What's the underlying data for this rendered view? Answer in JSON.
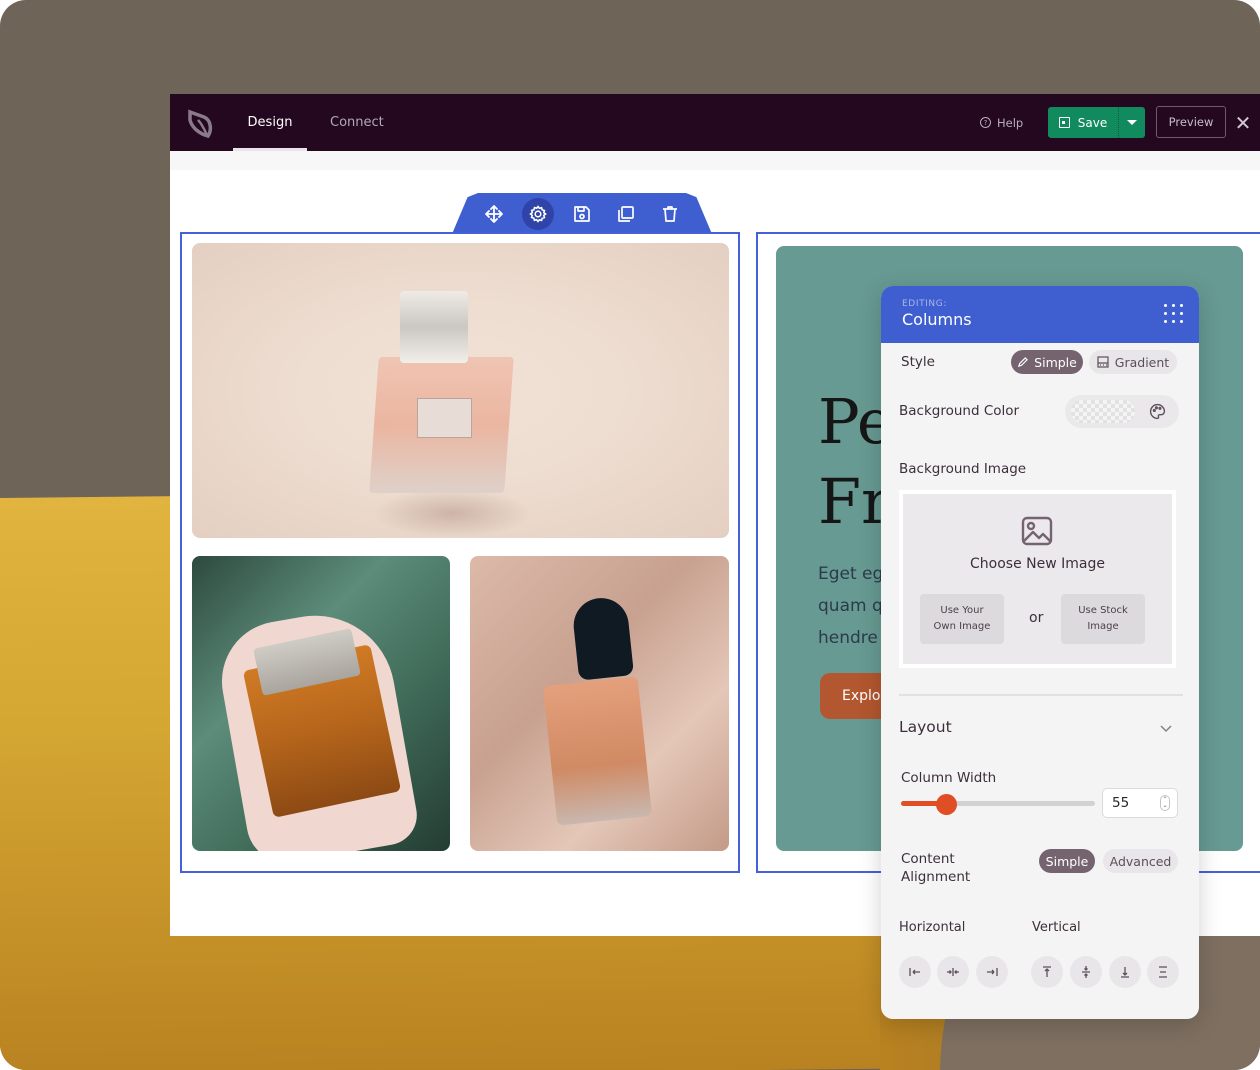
{
  "topbar": {
    "logo_icon": "leaf-logo-icon",
    "tabs": [
      {
        "label": "Design",
        "active": true
      },
      {
        "label": "Connect",
        "active": false
      }
    ],
    "help_label": "Help",
    "save_label": "Save",
    "preview_label": "Preview"
  },
  "block_toolbar": {
    "buttons": [
      {
        "icon": "move-icon",
        "active": false
      },
      {
        "icon": "settings-icon",
        "active": true
      },
      {
        "icon": "save-icon",
        "active": false
      },
      {
        "icon": "duplicate-icon",
        "active": false
      },
      {
        "icon": "trash-icon",
        "active": false
      }
    ]
  },
  "gallery": {
    "images": [
      {
        "alt": "Miss Dior perfume bottle"
      },
      {
        "alt": "Bvlgari Man Wood Neroli bottle in hand"
      },
      {
        "alt": "Giorgio Armani Si perfume bottle on satin"
      }
    ]
  },
  "hero": {
    "title": "Pe\nFr",
    "text": "Eget eg\nquam q\nhendre",
    "button_label": "Explor",
    "bg_color": "#679a92",
    "button_color": "#b2572f"
  },
  "panel": {
    "editing_label": "EDITING:",
    "title": "Columns",
    "style": {
      "label": "Style",
      "options": [
        {
          "label": "Simple",
          "icon": "pencil-icon",
          "active": true
        },
        {
          "label": "Gradient",
          "icon": "gradient-icon",
          "active": false
        }
      ]
    },
    "background_color": {
      "label": "Background Color",
      "value": "transparent"
    },
    "background_image": {
      "label": "Background Image",
      "choose_label": "Choose New Image",
      "own_image_label": "Use Your\nOwn Image",
      "or_label": "or",
      "stock_image_label": "Use Stock\nImage"
    },
    "layout": {
      "label": "Layout",
      "column_width_label": "Column Width",
      "column_width_value": "55",
      "slider_percent": 23,
      "content_alignment_label": "Content\nAlignment",
      "alignment_modes": [
        {
          "label": "Simple",
          "active": true
        },
        {
          "label": "Advanced",
          "active": false
        }
      ],
      "horizontal_label": "Horizontal",
      "vertical_label": "Vertical",
      "horizontal_buttons": [
        "align-left-icon",
        "align-center-h-icon",
        "align-right-icon"
      ],
      "vertical_buttons": [
        "align-top-icon",
        "align-middle-icon",
        "align-bottom-icon",
        "align-stretch-icon"
      ]
    }
  },
  "colors": {
    "topbar_bg": "#230820",
    "accent_blue": "#3f5fd1",
    "save_green": "#118a5e",
    "slider_orange": "#e04e23"
  }
}
